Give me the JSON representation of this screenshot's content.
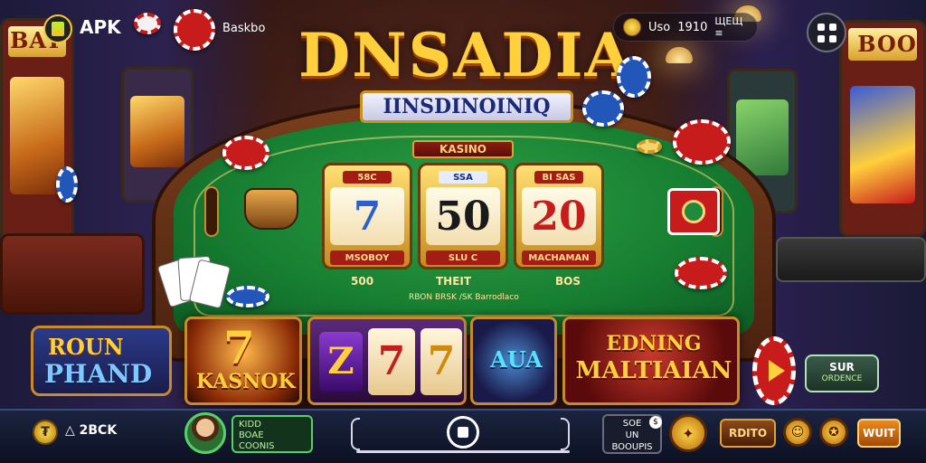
{
  "top_bar": {
    "apk_label": "APK",
    "top_link": "Baskbo",
    "status_left": "Uso",
    "status_value": "1910",
    "status_right": "ЩЕЩ ≡"
  },
  "title": {
    "main": "DNSADIA",
    "ribbon": "IINSDINOINIQ"
  },
  "arcades": {
    "left_marquee": "BAY",
    "right_marquee": "BOO"
  },
  "table": {
    "plate": "KASINO",
    "reels": [
      {
        "tag": "58C",
        "symbol": "7",
        "label": "MSOBOY",
        "symbol_color": "#2a5fd0",
        "tag_bg": "#a31d14",
        "tag_fg": "#ffd98a"
      },
      {
        "tag": "SSA",
        "symbol": "50",
        "label": "SLU C",
        "symbol_color": "#1a1a1a",
        "tag_bg": "#e6ecff",
        "tag_fg": "#1a2a7a"
      },
      {
        "tag": "BI SAS",
        "symbol": "20",
        "label": "MACHAMAN",
        "symbol_color": "#c81b1b",
        "tag_bg": "#a31d14",
        "tag_fg": "#ffd98a"
      }
    ],
    "bottom_left": "500",
    "bottom_mid": "THEIT",
    "bottom_right": "BOS",
    "footer": "RBON BRSK /SK Barrodlaco"
  },
  "tiles": {
    "left_banner_1": "ROUN",
    "left_banner_2": "PHAND",
    "tile1_symbol": "7",
    "tile1_text": "KASNOK",
    "tile2_symbols": [
      "Z",
      "7",
      "7"
    ],
    "tile3_text": "AUA",
    "tile4_line1": "EDNING",
    "tile4_line2": "MALTIAIAN"
  },
  "side": {
    "btn_main": "SUR",
    "btn_sub": "ORDENCE"
  },
  "bottom_bar": {
    "left_count": "2BCK",
    "user_line1": "KIDD",
    "user_line2": "BOAE",
    "user_line3": "COONIS",
    "info_line1": "SOE",
    "info_line2": "UN",
    "info_line3": "BOOUPIS",
    "btn1": "RDITO",
    "btn2": "WUIT"
  },
  "colors": {
    "gold": "#ffcf3c",
    "felt": "#178032",
    "chip_red": "#c81b1b",
    "chip_blue": "#2256b8"
  }
}
